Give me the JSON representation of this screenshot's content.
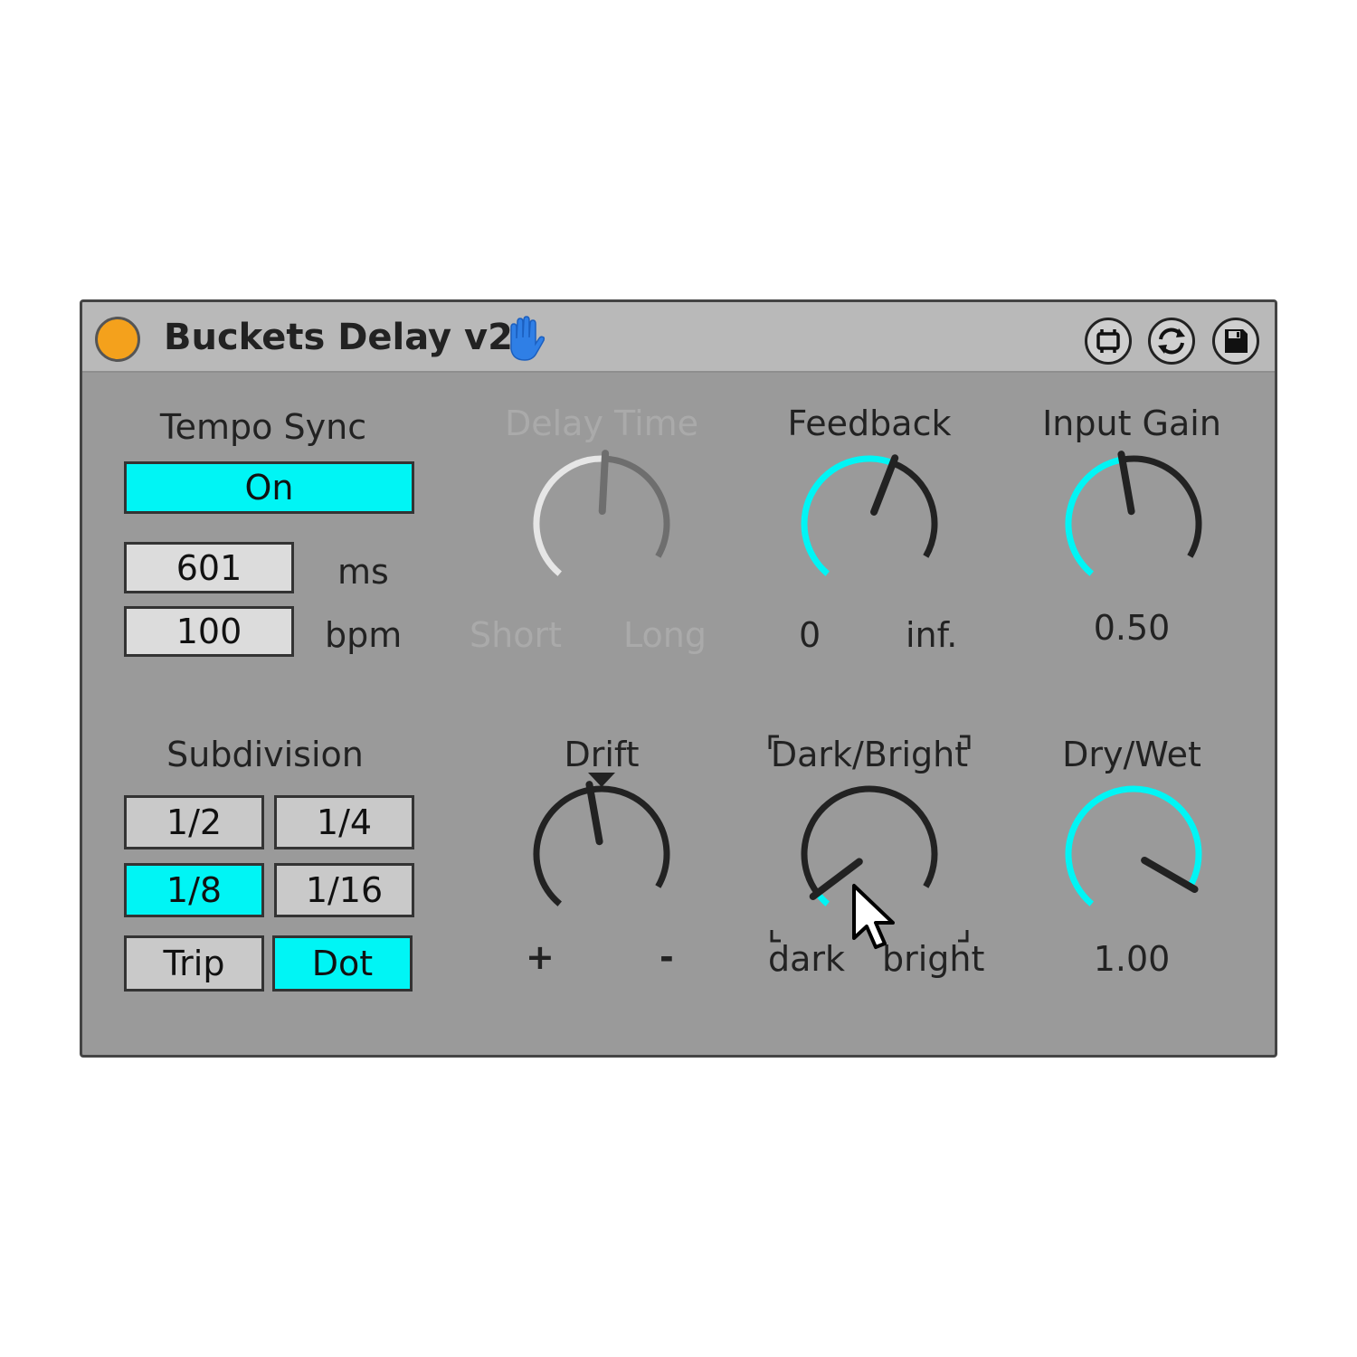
{
  "header": {
    "title": "Buckets Delay v2"
  },
  "colors": {
    "accent": "#00f5f5",
    "panel": "#9a9a9a",
    "power": "#f4a11c",
    "knob_track": "#222222",
    "disabled": "#aaaaaa"
  },
  "icons": {
    "power": "power-indicator",
    "hand": "hand-icon",
    "freeze": "freeze-icon",
    "hot_swap": "hot-swap-icon",
    "save": "save-icon"
  },
  "tempo_sync": {
    "label": "Tempo Sync",
    "toggle": "On",
    "ms_value": "601",
    "ms_unit": "ms",
    "bpm_value": "100",
    "bpm_unit": "bpm"
  },
  "delay_time": {
    "label": "Delay Time",
    "min_label": "Short",
    "max_label": "Long",
    "value": 0.55,
    "enabled": false
  },
  "feedback": {
    "label": "Feedback",
    "min_label": "0",
    "max_label": "inf.",
    "value": 0.62
  },
  "input_gain": {
    "label": "Input Gain",
    "display": "0.50",
    "value": 0.5
  },
  "subdivision": {
    "label": "Subdivision",
    "buttons": [
      "1/2",
      "1/4",
      "1/8",
      "1/16"
    ],
    "selected": "1/8",
    "trip": "Trip",
    "dot": "Dot",
    "dot_active": true,
    "trip_active": false
  },
  "drift": {
    "label": "Drift",
    "plus": "+",
    "minus": "-",
    "value": 0.5
  },
  "dark_bright": {
    "label": "Dark/Bright",
    "min_label": "dark",
    "max_label": "bright",
    "value": 0.05
  },
  "dry_wet": {
    "label": "Dry/Wet",
    "display": "1.00",
    "value": 1.0
  }
}
